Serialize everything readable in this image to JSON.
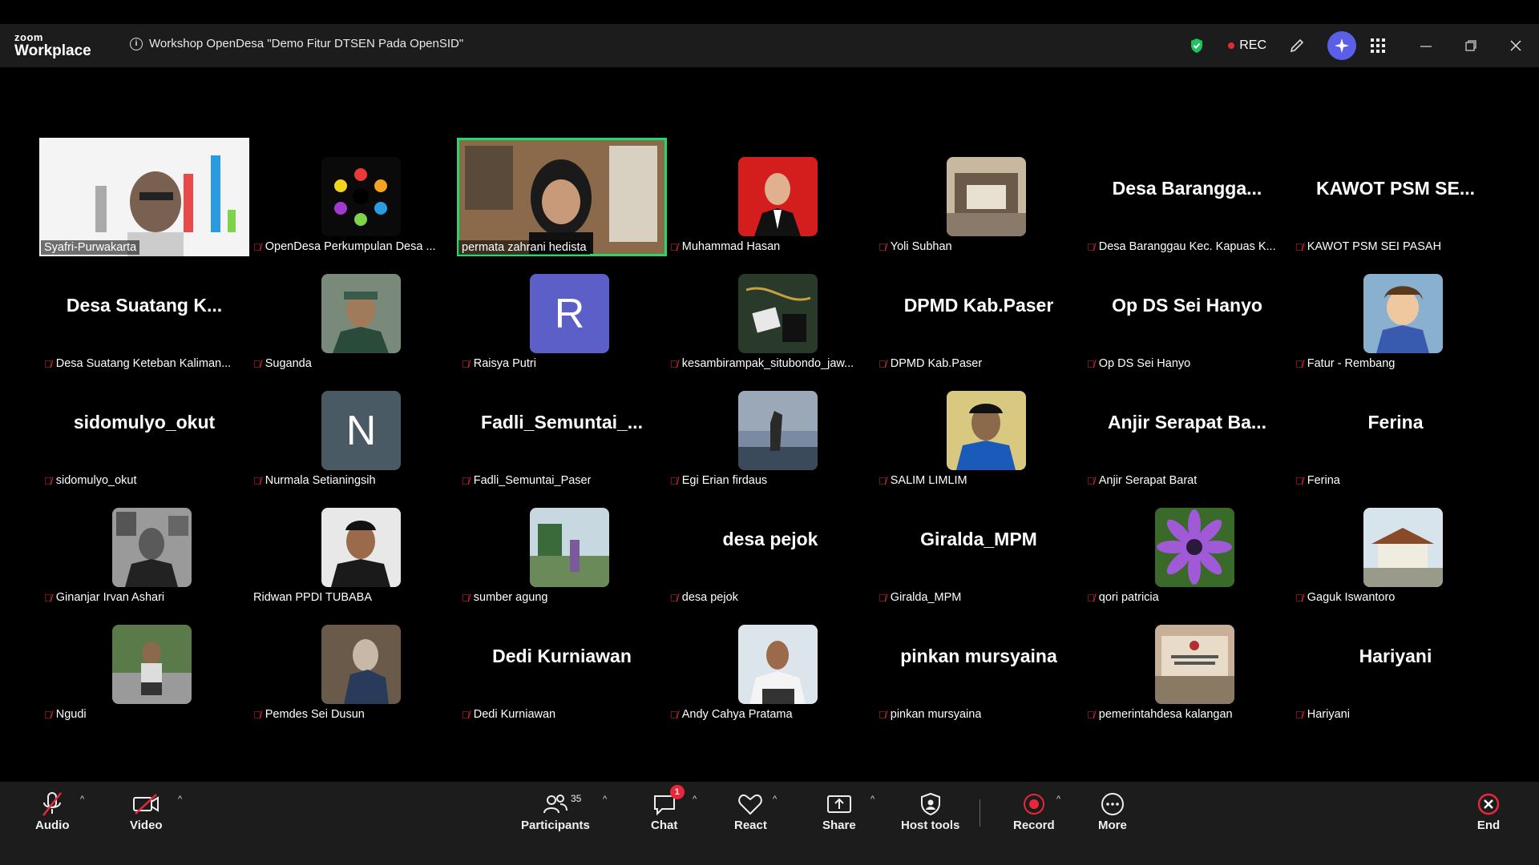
{
  "app": {
    "brand_top": "zoom",
    "brand_bottom": "Workplace",
    "meeting_title": "Workshop OpenDesa \"Demo Fitur DTSEN Pada OpenSID\"",
    "rec_label": "REC"
  },
  "participants_row1": [
    {
      "name": "Syafri-Purwakarta"
    },
    {
      "name": "OpenDesa Perkumpulan Desa ..."
    },
    {
      "name": "permata zahrani hedista"
    },
    {
      "name": "Muhammad Hasan"
    },
    {
      "name": "Yoli Subhan"
    },
    {
      "display": "Desa Barangga...",
      "name": "Desa Baranggau Kec. Kapuas K..."
    },
    {
      "display": "KAWOT PSM SE...",
      "name": "KAWOT PSM SEI PASAH"
    }
  ],
  "participants_row2": [
    {
      "display": "Desa Suatang K...",
      "name": "Desa Suatang Keteban Kaliman..."
    },
    {
      "name": "Suganda"
    },
    {
      "name": "Raisya Putri",
      "letter": "R"
    },
    {
      "name": "kesambirampak_situbondo_jaw..."
    },
    {
      "display": "DPMD Kab.Paser",
      "name": "DPMD Kab.Paser"
    },
    {
      "display": "Op DS Sei Hanyo",
      "name": "Op DS Sei Hanyo"
    },
    {
      "name": "Fatur - Rembang"
    }
  ],
  "participants_row3": [
    {
      "display": "sidomulyo_okut",
      "name": "sidomulyo_okut"
    },
    {
      "name": "Nurmala Setianingsih",
      "letter": "N"
    },
    {
      "display": "Fadli_Semuntai_...",
      "name": "Fadli_Semuntai_Paser"
    },
    {
      "name": "Egi Erian firdaus"
    },
    {
      "name": "SALIM LIMLIM"
    },
    {
      "display": "Anjir Serapat Ba...",
      "name": "Anjir Serapat Barat"
    },
    {
      "display": "Ferina",
      "name": "Ferina"
    }
  ],
  "participants_row4": [
    {
      "name": "Ginanjar Irvan Ashari"
    },
    {
      "name": "Ridwan PPDI TUBABA"
    },
    {
      "name": "sumber agung"
    },
    {
      "display": "desa pejok",
      "name": "desa pejok"
    },
    {
      "display": "Giralda_MPM",
      "name": "Giralda_MPM"
    },
    {
      "name": "qori patricia"
    },
    {
      "name": "Gaguk Iswantoro"
    }
  ],
  "participants_row5": [
    {
      "name": "Ngudi"
    },
    {
      "name": "Pemdes Sei Dusun"
    },
    {
      "display": "Dedi Kurniawan",
      "name": "Dedi Kurniawan"
    },
    {
      "name": "Andy Cahya Pratama"
    },
    {
      "display": "pinkan mursyaina",
      "name": "pinkan mursyaina"
    },
    {
      "name": "pemerintahdesa kalangan"
    },
    {
      "display": "Hariyani",
      "name": "Hariyani"
    }
  ],
  "toolbar": {
    "audio": "Audio",
    "video": "Video",
    "participants": "Participants",
    "participant_count": "35",
    "chat": "Chat",
    "chat_badge": "1",
    "react": "React",
    "share": "Share",
    "host_tools": "Host tools",
    "record": "Record",
    "more": "More",
    "end": "End"
  },
  "colors": {
    "active_speaker": "#23d96b",
    "muted": "#e8283a",
    "avatar_letter_bg_r": "#5b5fc7",
    "avatar_letter_bg_n": "#4a5a64"
  }
}
